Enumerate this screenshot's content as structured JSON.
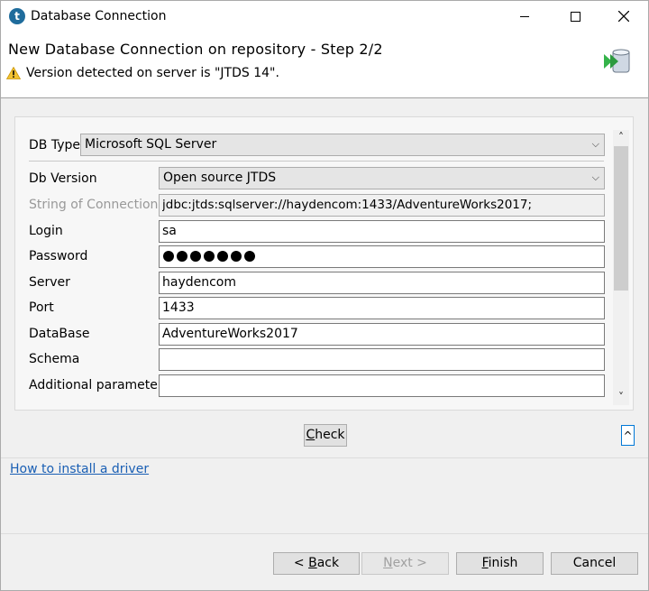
{
  "window": {
    "title": "Database Connection",
    "app_icon_glyph": "t"
  },
  "header": {
    "title": "New Database Connection on repository - Step 2/2",
    "message": "Version detected on server is \"JTDS 14\".",
    "warning_icon": "warning-icon",
    "banner_icon": "database-connection-icon"
  },
  "form": {
    "db_type": {
      "label": "DB Type",
      "value": "Microsoft SQL Server"
    },
    "db_version": {
      "label": "Db Version",
      "value": "Open source JTDS"
    },
    "connection_string": {
      "label": "String of Connection",
      "value": "jdbc:jtds:sqlserver://haydencom:1433/AdventureWorks2017;"
    },
    "login": {
      "label": "Login",
      "value": "sa"
    },
    "password": {
      "label": "Password",
      "masked_length": 7
    },
    "server": {
      "label": "Server",
      "value": "haydencom"
    },
    "port": {
      "label": "Port",
      "value": "1433"
    },
    "database": {
      "label": "DataBase",
      "value": "AdventureWorks2017"
    },
    "schema": {
      "label": "Schema",
      "value": ""
    },
    "additional_parameters": {
      "label": "Additional parameters",
      "value": ""
    }
  },
  "check_button": {
    "mnemonic": "C",
    "rest": "heck"
  },
  "collapse_button": {
    "label": "^"
  },
  "link": {
    "label": "How to install a driver"
  },
  "buttons": {
    "back": {
      "prefix": "< ",
      "mnemonic": "B",
      "rest": "ack"
    },
    "next": {
      "mnemonic": "N",
      "rest": "ext >"
    },
    "finish": {
      "mnemonic": "F",
      "rest": "inish"
    },
    "cancel": {
      "label": "Cancel"
    }
  },
  "colors": {
    "accent": "#0078d7",
    "link": "#1a5fb4",
    "banner_green": "#35b34a",
    "banner_blue": "#4a90d9"
  }
}
